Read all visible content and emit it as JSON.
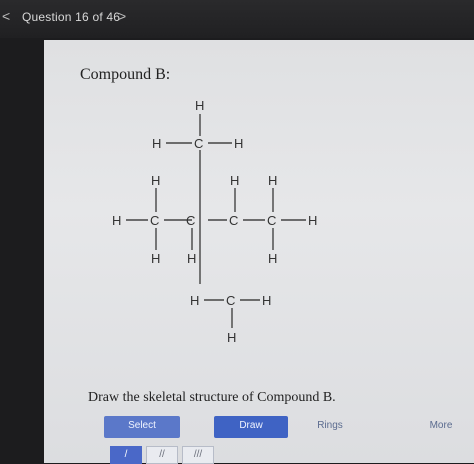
{
  "header": {
    "question_label": "Question 16 of 46",
    "next_glyph": ">",
    "prev_glyph": "<"
  },
  "compound": {
    "title": "Compound B:",
    "atoms": [
      "H",
      "H",
      "C",
      "H",
      "H",
      "H",
      "H",
      "H",
      "C",
      "C",
      "C",
      "C",
      "H",
      "H",
      "H",
      "H",
      "H",
      "C",
      "H",
      "H"
    ]
  },
  "prompt": "Draw the skeletal structure of Compound B.",
  "tabs": {
    "select": "Select",
    "draw": "Draw",
    "rings": "Rings",
    "more": "More"
  },
  "tools": [
    "/",
    "//",
    "///"
  ],
  "colors": {
    "accent": "#3f63c4",
    "panel": "#e0e1e3",
    "background": "#1c1c1e"
  }
}
